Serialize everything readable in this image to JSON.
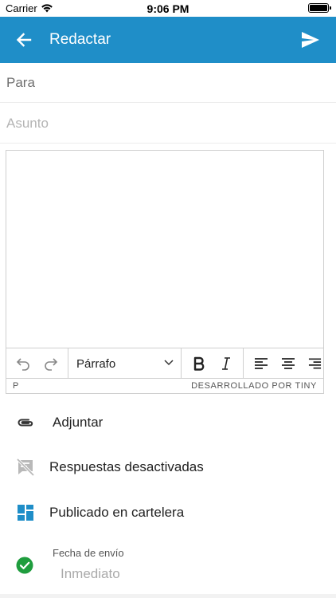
{
  "status_bar": {
    "carrier": "Carrier",
    "time": "9:06 PM"
  },
  "app_bar": {
    "title": "Redactar",
    "back_icon": "arrow-left-icon",
    "send_icon": "send-icon",
    "color": "#1f8ec8"
  },
  "compose": {
    "to_placeholder": "Para",
    "subject_placeholder": "Asunto"
  },
  "editor": {
    "format_label": "Párrafo",
    "path": "P",
    "powered_by": "DESARROLLADO POR TINY"
  },
  "options": {
    "attach": "Adjuntar",
    "replies": "Respuestas desactivadas",
    "board": "Publicado en cartelera"
  },
  "send_date": {
    "caption": "Fecha de envío",
    "value": "Inmediato",
    "check_color": "#1f9d3e"
  }
}
